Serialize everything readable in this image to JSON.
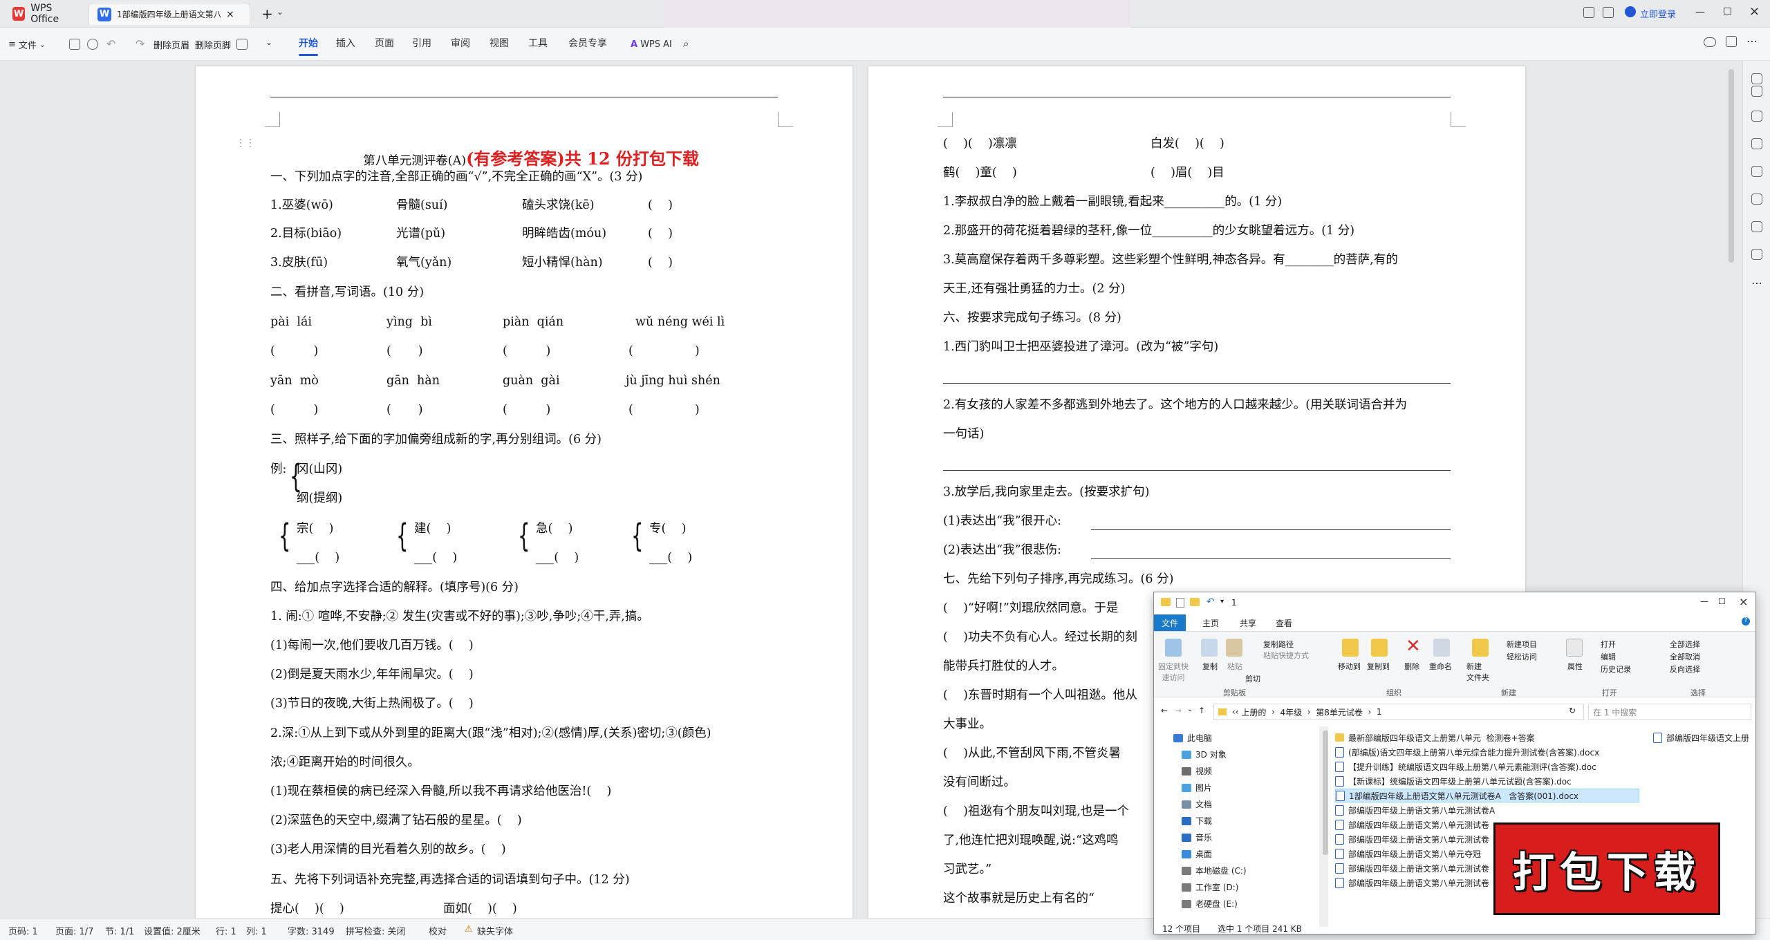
{
  "app": {
    "tabs": [
      {
        "label": "WPS Office"
      },
      {
        "label": "1部编版四年级上册语文第八单"
      }
    ],
    "login_label": "立即登录"
  },
  "toolbar": {
    "file_label": "文件",
    "del_header_label": "删除页眉",
    "del_footer_label": "删除页脚",
    "menus": [
      "开始",
      "插入",
      "页面",
      "引用",
      "审阅",
      "视图",
      "工具",
      "会员专享"
    ],
    "wps_ai_label": "WPS AI"
  },
  "page1": {
    "title": "第八单元测评卷(A)",
    "title_red": "(有参考答案)共 12 份打包下载",
    "lines": [
      "一、下列加点字的注音,全部正确的画“√”,不完全正确的画“X”。(3 分)",
      "1.巫婆(wō)",
      "骨髓(suí)",
      "磕头求饶(kē)",
      "(    )",
      "2.目标(biāo)",
      "光谱(pǔ)",
      "明眸皓齿(móu)",
      "(    )",
      "3.皮肤(fū)",
      "氧气(yǎn)",
      "短小精悍(hàn)",
      "(    )",
      "二、看拼音,写词语。(10 分)",
      "pài  lái",
      "yìng  bì",
      "piàn  qián",
      "wǔ néng wéi lì",
      "(          )",
      "(       )",
      "(          )",
      "(                )",
      "yān  mò",
      "gān  hàn",
      "guàn  gài",
      "jù jīng huì shén",
      "(          )",
      "(       )",
      "(          )",
      "(                )",
      "三、照样子,给下面的字加偏旁组成新的字,再分别组词。(6 分)",
      "例:",
      "冈(山冈)",
      "纲(提纲)",
      "宗(    )",
      "___(    )",
      "建(    )",
      "___(    )",
      "急(    )",
      "___(    )",
      "专(    )",
      "___(    )",
      "四、给加点字选择合适的解释。(填序号)(6 分)",
      "1. 闹:① 喧哗,不安静;② 发生(灾害或不好的事);③吵,争吵;④干,弄,搞。",
      "(1)每闹一次,他们要收几百万钱。(    )",
      "(2)倒是夏天雨水少,年年闹旱灾。(    )",
      "(3)节日的夜晚,大街上热闹极了。(    )",
      "2.深:①从上到下或从外到里的距离大(跟“浅”相对);②(感情)厚,(关系)密切;③(颜色)",
      "浓;④距离开始的时间很久。",
      "(1)现在蔡桓侯的病已经深入骨髓,所以我不再请求给他医治!(    )",
      "(2)深蓝色的天空中,缀满了钻石般的星星。(    )",
      "(3)老人用深情的目光看着久别的故乡。(    )",
      "五、先将下列词语补充完整,再选择合适的词语填到句子中。(12 分)",
      "提心(    )(    )",
      "面如(    )(    )"
    ]
  },
  "page2": {
    "lines": [
      "(    )(    )凛凛",
      "白发(    )(    )",
      "鹤(    )童(    )",
      "(    )眉(    )目",
      "1.李叔叔白净的脸上戴着一副眼镜,看起来__________的。(1 分)",
      "2.那盛开的荷花挺着碧绿的茎秆,像一位__________的少女眺望着远方。(1 分)",
      "3.莫高窟保存着两千多尊彩塑。这些彩塑个性鲜明,神态各异。有________的菩萨,有的",
      "天王,还有强壮勇猛的力士。(2 分)",
      "六、按要求完成句子练习。(8 分)",
      "1.西门豹叫卫士把巫婆投进了漳河。(改为“被”字句)",
      "2.有女孩的人家差不多都逃到外地去了。这个地方的人口越来越少。(用关联词语合并为",
      "一句话)",
      "3.放学后,我向家里走去。(按要求扩句)",
      "(1)表达出“我”很开心:",
      "(2)表达出“我”很悲伤:",
      "七、先给下列句子排序,再完成练习。(6 分)",
      "(    )“好啊!”刘琨欣然同意。于是",
      "(    )功夫不负有心人。经过长期的刻",
      "能带兵打胜仗的人才。",
      "(    )东晋时期有一个人叫祖逖。他从",
      "大事业。",
      "(    )从此,不管刮风下雨,不管炎暑",
      "没有间断过。",
      "(    )祖逖有个朋友叫刘琨,也是一个",
      "了,他连忙把刘琨唤醒,说:“这鸡鸣",
      "习武艺。”",
      "这个故事就是历史上有名的“"
    ]
  },
  "statusbar": {
    "page": "页码: 1",
    "pages": "页面: 1/7",
    "section": "节: 1/1",
    "setting": "设置值: 2厘米",
    "row": "行: 1",
    "col": "列: 1",
    "words": "字数: 3149",
    "spell": "拼写检查: 关闭",
    "proof": "校对",
    "font_missing": "缺失字体"
  },
  "explorer": {
    "title": "1",
    "ribbon_tabs": [
      "文件",
      "主页",
      "共享",
      "查看"
    ],
    "ribbon_buttons": {
      "pin": "固定到快\n速访问",
      "copy": "复制",
      "paste": "粘贴",
      "copy_path": "复制路径",
      "paste_shortcut": "粘贴快捷方式",
      "cut": "剪切",
      "move_to": "移动到",
      "copy_to": "复制到",
      "delete": "删除",
      "rename": "重命名",
      "new_folder": "新建\n文件夹",
      "new_item": "新建项目",
      "easy_access": "轻松访问",
      "properties": "属性",
      "open": "打开",
      "edit": "编辑",
      "history": "历史记录",
      "select_all": "全部选择",
      "select_none": "全部取消",
      "invert": "反向选择"
    },
    "ribbon_groups": [
      "剪贴板",
      "组织",
      "新建",
      "打开",
      "选择"
    ],
    "address": [
      "上册的",
      "4年级",
      "第8单元试卷",
      "1"
    ],
    "search_placeholder": "在 1 中搜索",
    "nav": [
      {
        "label": "此电脑",
        "color": "#3a7bd5"
      },
      {
        "label": "3D 对象",
        "color": "#4aa3df"
      },
      {
        "label": "视频",
        "color": "#6d6d6d"
      },
      {
        "label": "图片",
        "color": "#4aa3df"
      },
      {
        "label": "文档",
        "color": "#7a8ea6"
      },
      {
        "label": "下载",
        "color": "#2b6cc4"
      },
      {
        "label": "音乐",
        "color": "#2b6cc4"
      },
      {
        "label": "桌面",
        "color": "#3a8be0"
      },
      {
        "label": "本地磁盘 (C:)",
        "color": "#7a7a7a"
      },
      {
        "label": "工作室 (D:)",
        "color": "#7a7a7a"
      },
      {
        "label": "老硬盘 (E:)",
        "color": "#7a7a7a"
      }
    ],
    "files": [
      {
        "name": "最新部编版四年级语文上册第八单元  检测卷+答案",
        "type": "folder"
      },
      {
        "name": "(部编版)语文四年级上册第八单元综合能力提升测试卷(含答案).docx",
        "type": "doc"
      },
      {
        "name": "【提升训练】统编版语文四年级上册第八单元素能测评(含答案).doc",
        "type": "doc"
      },
      {
        "name": "【新课标】统编版语文四年级上册第八单元试题(含答案).doc",
        "type": "doc"
      },
      {
        "name": "1部编版四年级上册语文第八单元测试卷A   含答案(001).docx",
        "type": "doc",
        "selected": true
      },
      {
        "name": "部编版四年级上册语文第八单元测试卷A",
        "type": "doc"
      },
      {
        "name": "部编版四年级上册语文第八单元测试卷",
        "type": "doc"
      },
      {
        "name": "部编版四年级上册语文第八单元测试卷",
        "type": "doc"
      },
      {
        "name": "部编版四年级上册语文第八单元夺冠",
        "type": "doc"
      },
      {
        "name": "部编版四年级上册语文第八单元测试卷",
        "type": "doc"
      },
      {
        "name": "部编版四年级上册语文第八单元测试卷",
        "type": "doc"
      }
    ],
    "files_col2": "部编版四年级语文上册",
    "status_count": "12 个项目",
    "status_sel": "选中 1 个项目  241 KB"
  },
  "banner": {
    "label": "打包下载"
  }
}
